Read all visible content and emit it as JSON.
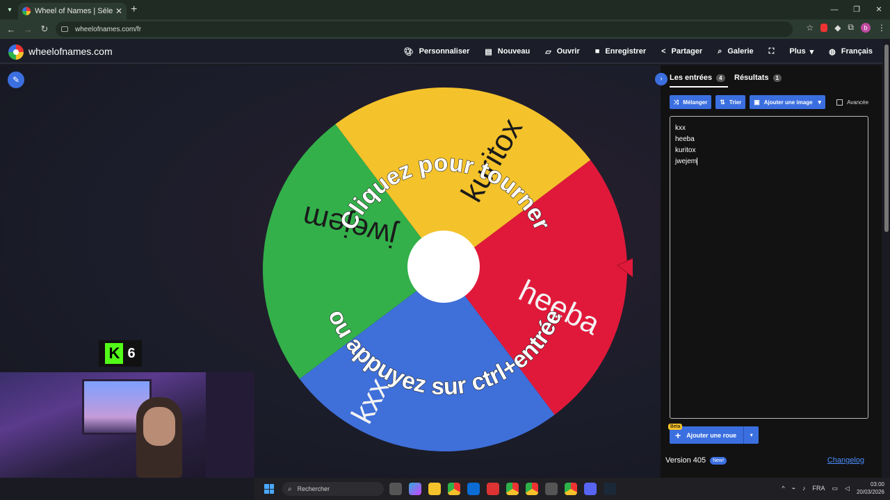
{
  "browser": {
    "tab_title": "Wheel of Names | Sélecteur de",
    "url": "wheelofnames.com/fr",
    "profile_initial": "b"
  },
  "site": {
    "brand": "wheelofnames.com",
    "menu": [
      {
        "label": "Personnaliser",
        "icon": "palette-icon"
      },
      {
        "label": "Nouveau",
        "icon": "file-icon"
      },
      {
        "label": "Ouvrir",
        "icon": "folder-open-icon"
      },
      {
        "label": "Enregistrer",
        "icon": "save-icon"
      },
      {
        "label": "Partager",
        "icon": "share-icon"
      },
      {
        "label": "Galerie",
        "icon": "search-icon"
      },
      {
        "label": "",
        "icon": "fullscreen-icon"
      },
      {
        "label": "Plus",
        "icon": "chevron-down-icon"
      },
      {
        "label": "Français",
        "icon": "globe-icon"
      }
    ]
  },
  "wheel": {
    "center_prompt_top": "Cliquez pour tourner",
    "center_prompt_bottom": "ou appuyez sur ctrl+entrée",
    "segments": [
      {
        "label": "kuritox",
        "color": "#f4c22b"
      },
      {
        "label": "heeba",
        "color": "#e0193a"
      },
      {
        "label": "kxx",
        "color": "#3f6fd9"
      },
      {
        "label": "jwejem",
        "color": "#33b04a"
      }
    ]
  },
  "overlay": {
    "kick_viewers": "6"
  },
  "panel": {
    "tab_entries": "Les entrées",
    "tab_entries_count": "4",
    "tab_results": "Résultats",
    "tab_results_count": "1",
    "shuffle_label": "Mélanger",
    "sort_label": "Trier",
    "add_image_label": "Ajouter une image",
    "advanced_label": "Avancée",
    "entries": [
      "kxx",
      "heeba",
      "kuritox",
      "jwejem"
    ],
    "beta_badge": "Beta",
    "add_wheel_label": "Ajouter une roue",
    "version": "Version 405",
    "new_badge": "New!",
    "changelog": "Changelog"
  },
  "taskbar": {
    "search_placeholder": "Rechercher",
    "language": "FRA",
    "time": "03:00",
    "date": "20/03/2026"
  }
}
